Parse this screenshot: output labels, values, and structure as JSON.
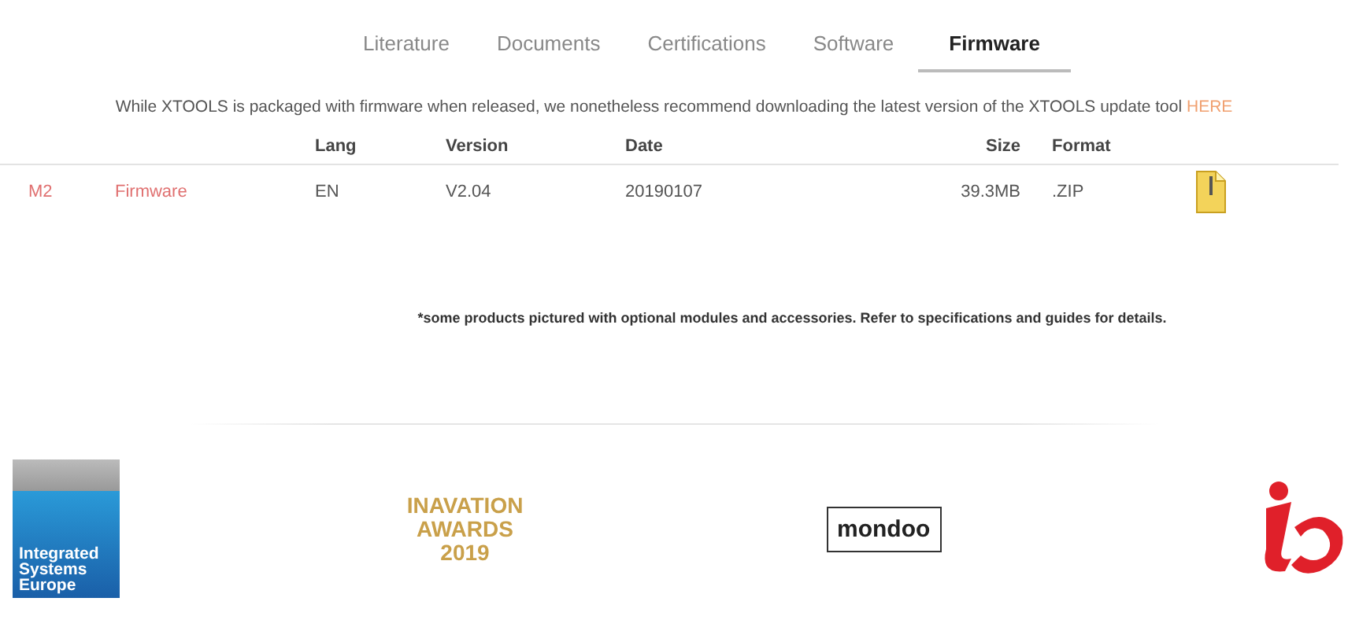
{
  "tabs": [
    {
      "label": "Literature",
      "selected": false
    },
    {
      "label": "Documents",
      "selected": false
    },
    {
      "label": "Certifications",
      "selected": false
    },
    {
      "label": "Software",
      "selected": false
    },
    {
      "label": "Firmware",
      "selected": true
    }
  ],
  "notice": {
    "text": "While XTOOLS is packaged with firmware when released, we nonetheless recommend downloading the latest version of the XTOOLS update tool ",
    "link": "HERE"
  },
  "table": {
    "columns": [
      "Lang",
      "Version",
      "Date",
      "Size",
      "Format"
    ],
    "rows": [
      {
        "model": "M2",
        "name": "Firmware",
        "lang": "EN",
        "version": "V2.04",
        "date": "20190107",
        "size": "39.3MB",
        "format": ".ZIP"
      }
    ]
  },
  "footnote": "*some products pictured with optional modules and accessories. Refer to specifications and guides for details.",
  "sponsors": [
    {
      "kind": "ise",
      "lines": [
        "Integrated",
        "Systems",
        "Europe"
      ]
    },
    {
      "kind": "award",
      "lines": [
        "INAVATION",
        "AWARDS",
        "2019"
      ]
    },
    {
      "kind": "mondoo",
      "lines": [
        "mondoo"
      ]
    },
    {
      "kind": "ibc"
    }
  ]
}
